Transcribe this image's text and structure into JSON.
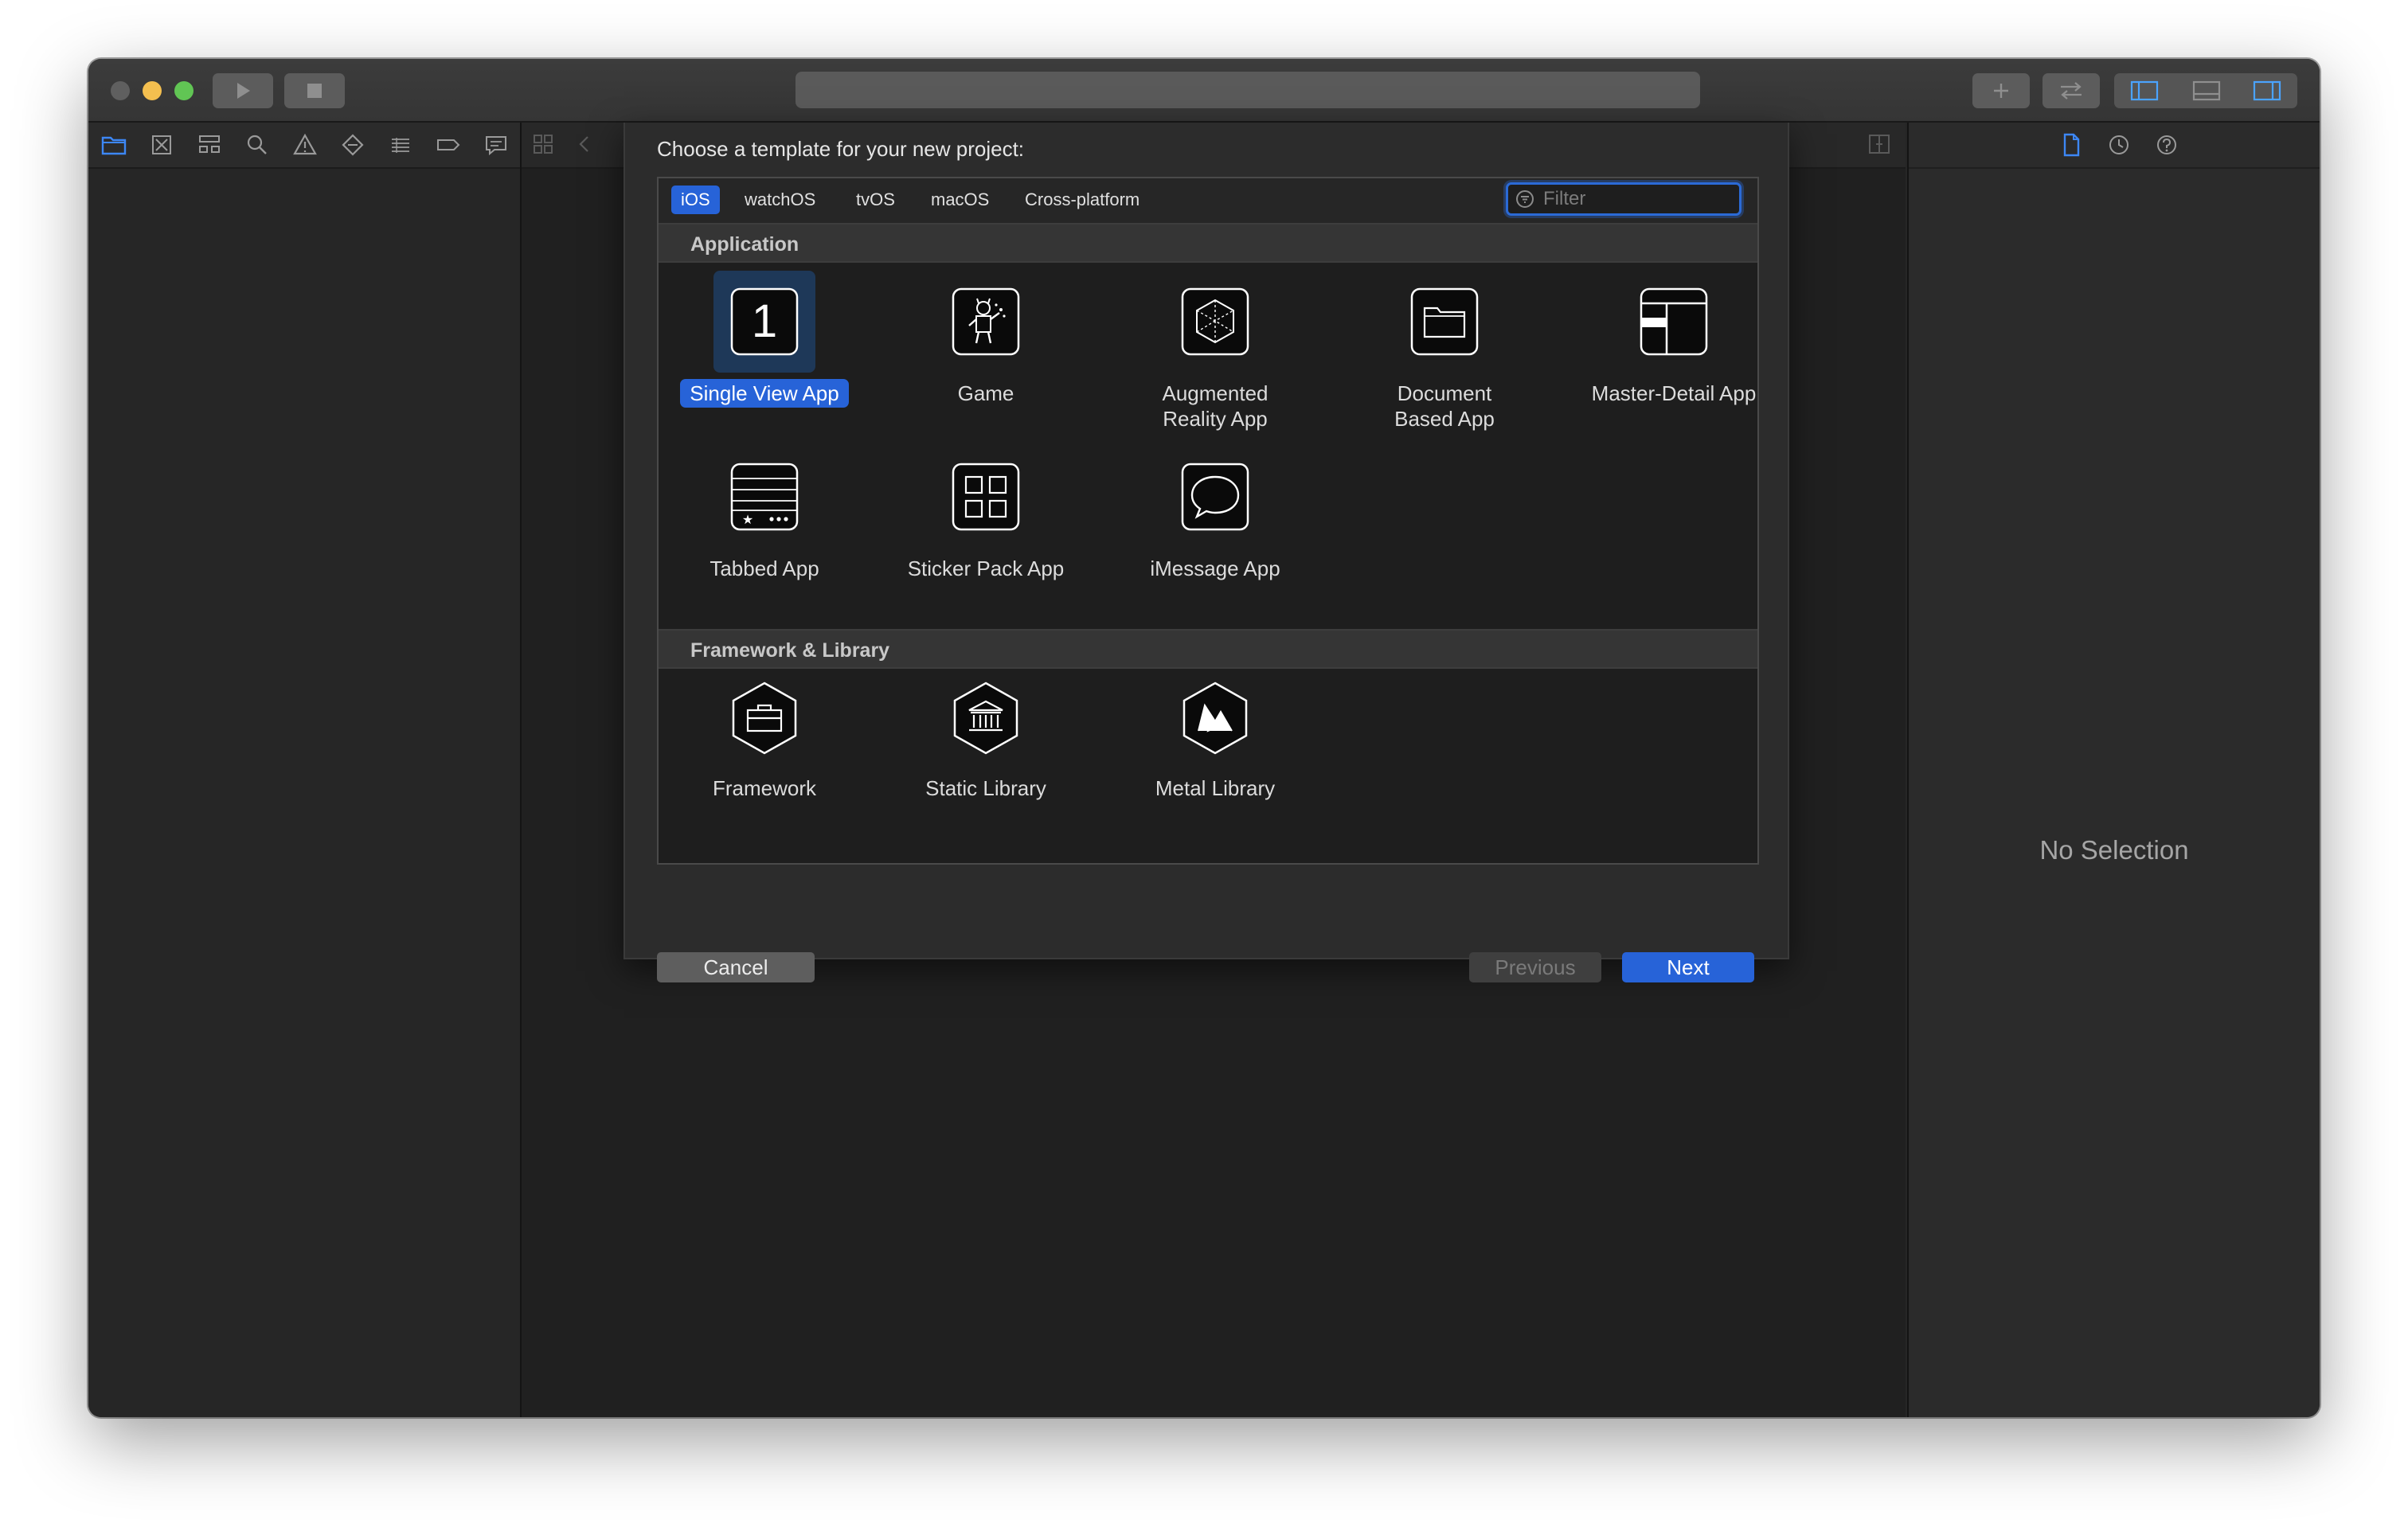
{
  "sheet": {
    "title": "Choose a template for your new project:",
    "filter_placeholder": "Filter"
  },
  "platform_tabs": [
    "iOS",
    "watchOS",
    "tvOS",
    "macOS",
    "Cross-platform"
  ],
  "selected_tab": "iOS",
  "sections": {
    "application": {
      "header": "Application",
      "items": [
        {
          "label": "Single View App",
          "icon": "single-view-app-icon"
        },
        {
          "label": "Game",
          "icon": "game-icon"
        },
        {
          "label": "Augmented\nReality App",
          "icon": "augmented-reality-icon"
        },
        {
          "label": "Document\nBased App",
          "icon": "document-based-icon"
        },
        {
          "label": "Master-Detail App",
          "icon": "master-detail-icon"
        },
        {
          "label": "Tabbed App",
          "icon": "tabbed-app-icon"
        },
        {
          "label": "Sticker Pack App",
          "icon": "sticker-pack-icon"
        },
        {
          "label": "iMessage App",
          "icon": "imessage-icon"
        }
      ]
    },
    "framework": {
      "header": "Framework & Library",
      "items": [
        {
          "label": "Framework",
          "icon": "framework-icon"
        },
        {
          "label": "Static Library",
          "icon": "static-library-icon"
        },
        {
          "label": "Metal Library",
          "icon": "metal-library-icon"
        }
      ]
    }
  },
  "selected_template": "Single View App",
  "buttons": {
    "cancel": "Cancel",
    "previous": "Previous",
    "next": "Next"
  },
  "inspector": {
    "empty_text": "No Selection"
  },
  "colors": {
    "accent": "#2763d8",
    "close": "#ec6a5e",
    "minimize": "#f4bf4f",
    "zoom": "#61c554",
    "nav_active": "#3d87f5"
  }
}
